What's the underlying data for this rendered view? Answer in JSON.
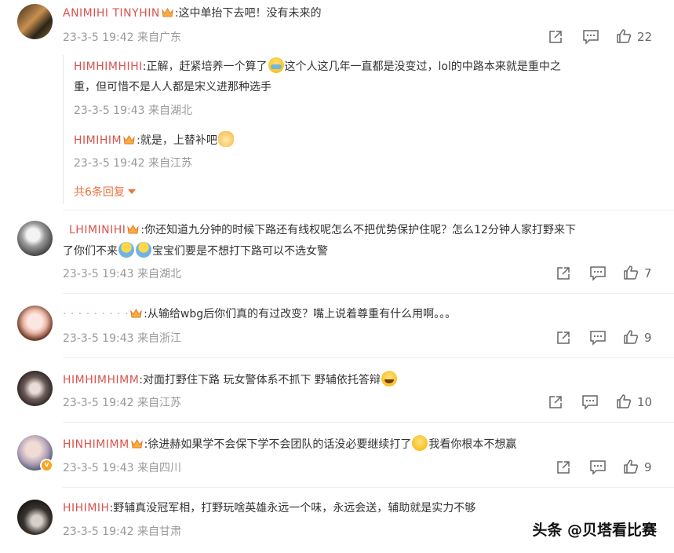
{
  "comments": [
    {
      "username": "ANIMIHI TINYHIN",
      "text": ":这中单抬下去吧！没有未来的",
      "meta": "23-3-5 19:42 来自广东",
      "likes": "22"
    },
    {
      "username": "LHIMINIHI",
      "text_line1": ":你还知道九分钟的时候下路还有线权呢怎么不把优势保护住呢？怎么12分钟人家打野来下",
      "text_line2_a": "了你们不来",
      "text_line2_b": "宝宝们要是不想打下路可以不选女警",
      "meta": "23-3-5 19:43 来自湖北",
      "likes": "7"
    },
    {
      "username": "· · · · · · · · ·",
      "text": ":从输给wbg后你们真的有过改变？嘴上说着尊重有什么用啊。。。",
      "meta": "23-3-5 19:43 来自浙江",
      "likes": "9"
    },
    {
      "username": "HIMHIMHIMM",
      "text_a": ":对面打野住下路 玩女警体系不抓下 野辅依托答辩",
      "meta": "23-3-5 19:42 来自江苏",
      "likes": "10"
    },
    {
      "username": "HINHIMIMM",
      "text_a": ":徐进赫如果学不会保下学不会团队的话没必要继续打了",
      "text_b": "我看你根本不想赢",
      "meta": "23-3-5 19:43 来自四川",
      "likes": "9"
    },
    {
      "username": "HIHIMIH",
      "text": ":野辅真没冠军相，打野玩啥英雄永远一个味，永远会送，辅助就是实力不够",
      "meta": "23-3-5 19:42 来自甘肃"
    }
  ],
  "replies": [
    {
      "username": "HIMHIMHIHI",
      "text_line1_a": ":正解，赶紧培养一个算了",
      "text_line1_b": "这个人这几年一直都是没变过，lol的中路本来就是重中之",
      "text_line2": "重，但可惜不是人人都是宋义进那种选手",
      "meta": "23-3-5 19:43 来自湖北"
    },
    {
      "username": "HIMIHIM",
      "text": ":就是，上替补吧",
      "meta": "23-3-5 19:42 来自江苏"
    }
  ],
  "more_replies": "共6条回复",
  "watermark": "头条 @贝塔看比赛",
  "colors": {
    "username": "#d9534f",
    "link": "#eb7340",
    "meta": "#999999"
  },
  "icons": [
    "share-icon",
    "comment-icon",
    "like-icon",
    "crown-badge-icon",
    "verified-badge-icon"
  ]
}
